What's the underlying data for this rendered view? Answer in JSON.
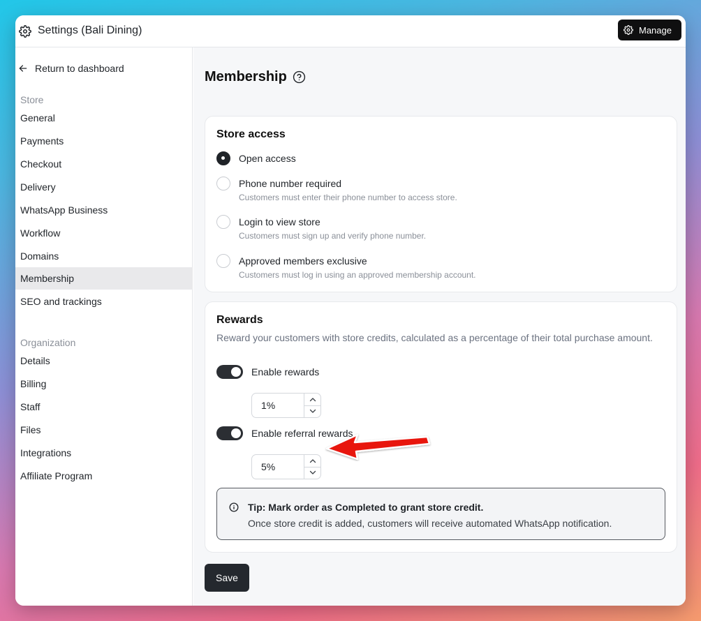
{
  "window": {
    "title": "Settings (Bali Dining)",
    "manage_label": "Manage"
  },
  "sidebar": {
    "back_label": "Return to dashboard",
    "store_label": "Store",
    "store_items": [
      {
        "label": "General"
      },
      {
        "label": "Payments"
      },
      {
        "label": "Checkout"
      },
      {
        "label": "Delivery"
      },
      {
        "label": "WhatsApp Business"
      },
      {
        "label": "Workflow"
      },
      {
        "label": "Domains"
      },
      {
        "label": "Membership",
        "active": true
      },
      {
        "label": "SEO and trackings"
      }
    ],
    "org_label": "Organization",
    "org_items": [
      {
        "label": "Details"
      },
      {
        "label": "Billing"
      },
      {
        "label": "Staff"
      },
      {
        "label": "Files"
      },
      {
        "label": "Integrations"
      },
      {
        "label": "Affiliate Program"
      }
    ]
  },
  "main": {
    "title": "Membership",
    "store_access": {
      "title": "Store access",
      "options": [
        {
          "label": "Open access",
          "desc": "",
          "selected": true
        },
        {
          "label": "Phone number required",
          "desc": "Customers must enter their phone number to access store.",
          "selected": false
        },
        {
          "label": "Login to view store",
          "desc": "Customers must sign up and verify phone number.",
          "selected": false
        },
        {
          "label": "Approved members exclusive",
          "desc": "Customers must log in using an approved membership account.",
          "selected": false
        }
      ]
    },
    "rewards": {
      "title": "Rewards",
      "description": "Reward your customers with store credits, calculated as a percentage of their total purchase amount.",
      "enable_rewards_label": "Enable rewards",
      "enable_rewards_on": true,
      "rewards_value": "1%",
      "enable_referral_label": "Enable referral rewards",
      "enable_referral_on": true,
      "referral_value": "5%",
      "tip_title": "Tip: Mark order as Completed to grant store credit.",
      "tip_body": "Once store credit is added, customers will receive automated WhatsApp notification."
    },
    "save_label": "Save"
  },
  "colors": {
    "primary_dark": "#24282e",
    "annotation_arrow": "#e8130f"
  }
}
